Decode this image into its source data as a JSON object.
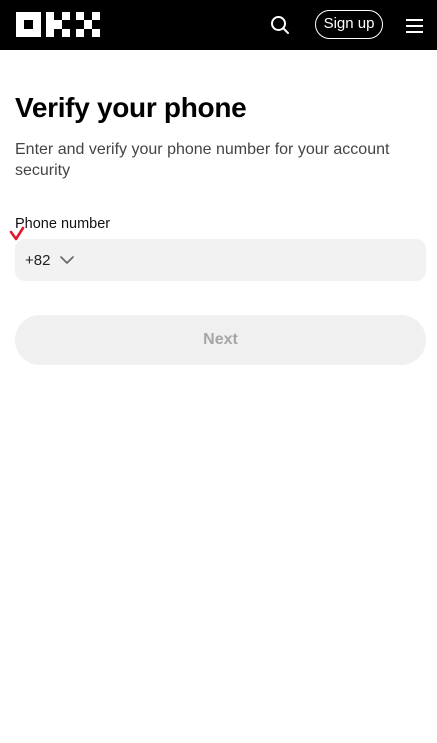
{
  "header": {
    "logo_icon": "okx-logo-icon",
    "search_icon": "search-icon",
    "signup_label": "Sign up",
    "menu_icon": "hamburger-menu-icon",
    "background_color": "#000000"
  },
  "main": {
    "title": "Verify your phone",
    "subtitle": "Enter and verify your phone number for your account security",
    "phone_label": "Phone number",
    "label_marker_icon": "red-checkmark-icon",
    "country_code": "+82",
    "country_code_icon": "chevron-down-icon",
    "phone_value": "",
    "next_label": "Next"
  }
}
